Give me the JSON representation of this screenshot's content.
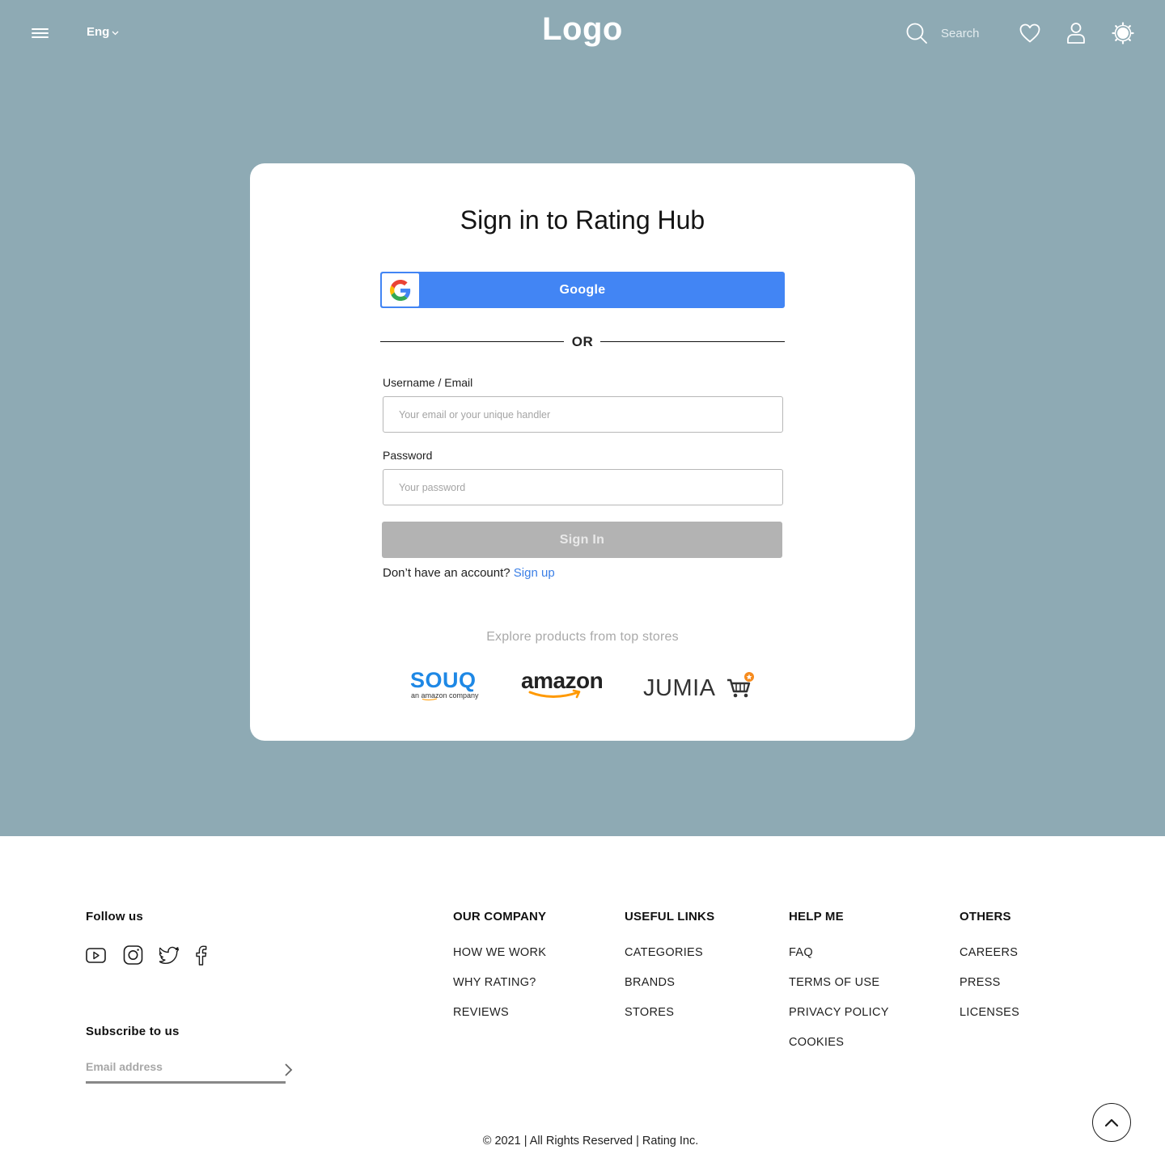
{
  "header": {
    "language": "Eng",
    "logo": "Logo",
    "search_placeholder": "Search"
  },
  "signin": {
    "title": "Sign in to Rating Hub",
    "google_label": "Google",
    "or_label": "OR",
    "username_label": "Username / Email",
    "username_placeholder": "Your email or your unique handler",
    "password_label": "Password",
    "password_placeholder": "Your password",
    "submit_label": "Sign In",
    "no_account_text": "Don’t have an account? ",
    "signup_link": "Sign up"
  },
  "stores": {
    "heading": "Explore products from top stores",
    "items": [
      {
        "name": "SOUQ",
        "sub": "an amazon company"
      },
      {
        "name": "amazon"
      },
      {
        "name": "JUMIA"
      }
    ]
  },
  "footer": {
    "follow_heading": "Follow us",
    "social": [
      "youtube-icon",
      "instagram-icon",
      "twitter-icon",
      "facebook-icon"
    ],
    "subscribe_heading": "Subscribe to us",
    "subscribe_placeholder": "Email address",
    "columns": [
      {
        "heading": "OUR COMPANY",
        "links": [
          "HOW WE WORK",
          "WHY RATING?",
          "REVIEWS"
        ]
      },
      {
        "heading": "USEFUL LINKS",
        "links": [
          "CATEGORIES",
          "BRANDS",
          "STORES"
        ]
      },
      {
        "heading": "HELP ME",
        "links": [
          "FAQ",
          "TERMS OF USE",
          "PRIVACY POLICY",
          "COOKIES"
        ]
      },
      {
        "heading": "OTHERS",
        "links": [
          "CAREERS",
          "PRESS",
          "LICENSES"
        ]
      }
    ],
    "copyright": "© 2021 | All Rights Reserved | Rating Inc."
  },
  "colors": {
    "hero_bg": "#8eaab4",
    "google_blue": "#4285f4",
    "disabled_button": "#b3b3b3",
    "link_blue": "#3b7fe6",
    "souq_blue": "#1e88e5",
    "amazon_orange": "#ff9900",
    "jumia_orange": "#f68b1e"
  }
}
